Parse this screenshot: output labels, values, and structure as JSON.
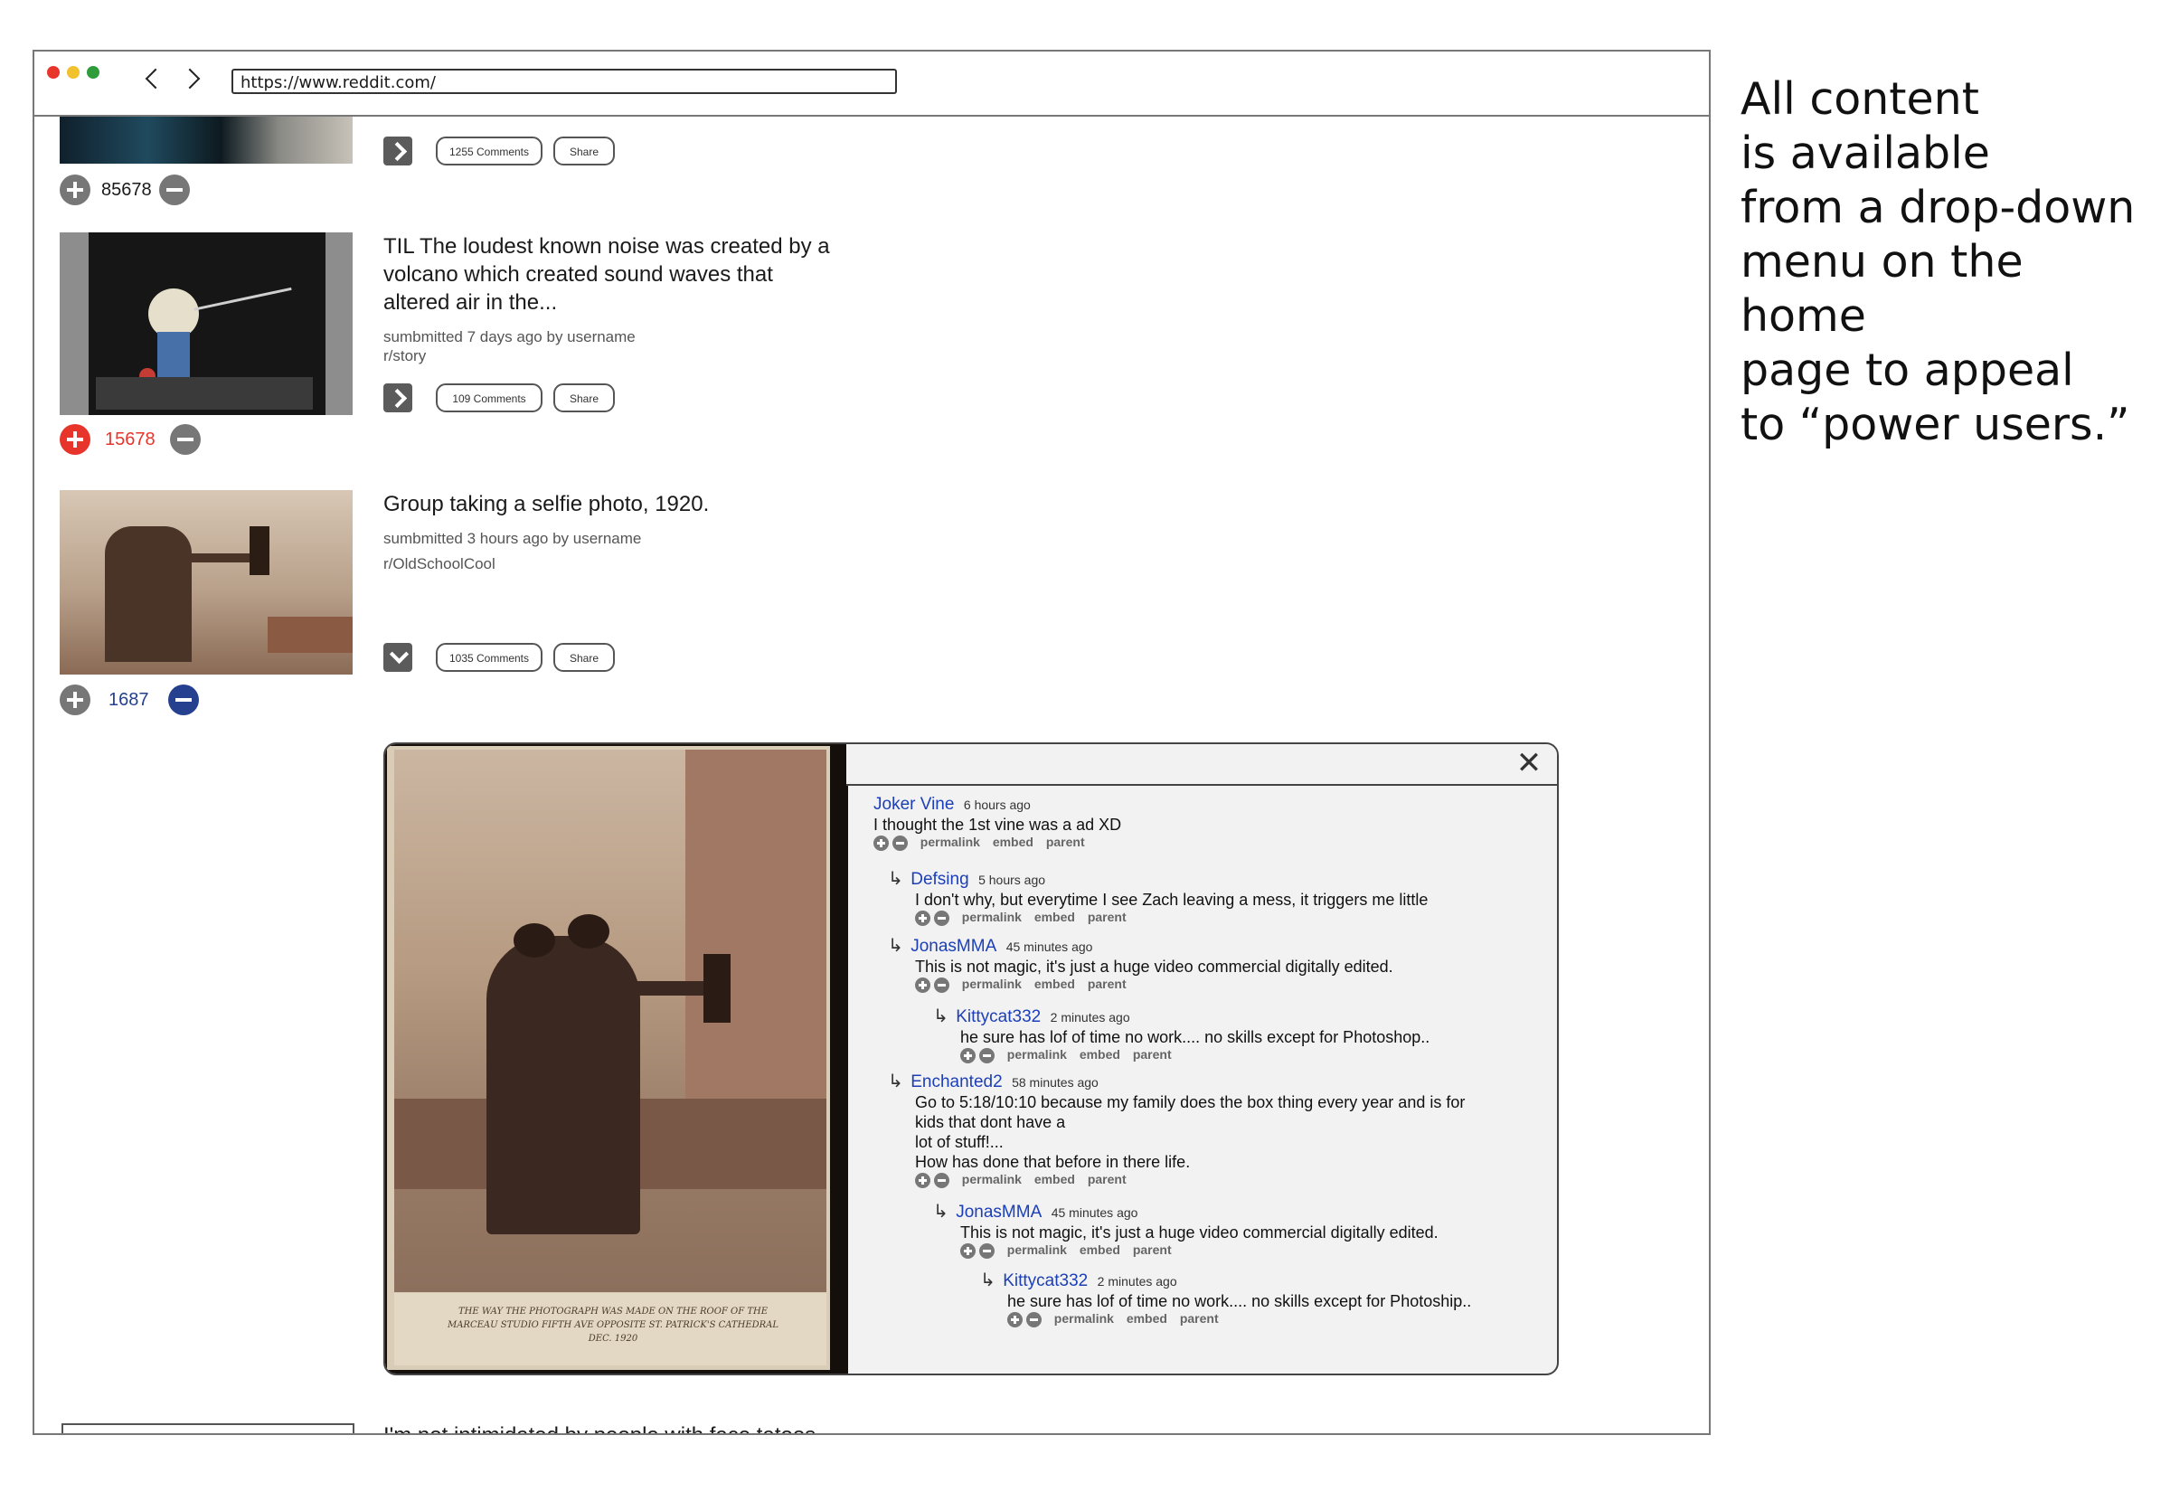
{
  "browser": {
    "url": "https://www.reddit.com/",
    "dots": {
      "red": "#e8352c",
      "yellow": "#f2c12e",
      "green": "#2e9c3b"
    }
  },
  "posts": [
    {
      "score": "85678",
      "comments_label": "1255 Comments",
      "share_label": "Share"
    },
    {
      "title": "TIL The loudest known noise was created by a volcano which created sound waves that altered air in the...",
      "meta": "sumbmitted 7 days ago by username",
      "subreddit": "r/story",
      "score": "15678",
      "comments_label": "109 Comments",
      "share_label": "Share"
    },
    {
      "title": "Group taking a selfie photo, 1920.",
      "meta": "sumbmitted 3 hours ago by username",
      "subreddit": "r/OldSchoolCool",
      "score": "1687",
      "comments_label": "1035 Comments",
      "share_label": "Share"
    },
    {
      "title": "I'm not intimidated by people with face tatoos because I think they're badass,"
    }
  ],
  "panel": {
    "close": "✕",
    "photo_caption": "THE WAY THE PHOTOGRAPH WAS MADE ON THE ROOF OF THE MARCEAU STUDIO FIFTH AVE OPPOSITE ST. PATRICK'S CATHEDRAL DEC. 1920",
    "actions": {
      "permalink": "permalink",
      "embed": "embed",
      "parent": "parent"
    },
    "comments": [
      {
        "user": "Joker Vine",
        "time": "6 hours ago",
        "text": "I thought the 1st vine was a ad XD"
      },
      {
        "user": "Defsing",
        "time": "5 hours ago",
        "text": "I don't why, but everytime I see Zach leaving a mess, it triggers me little"
      },
      {
        "user": "JonasMMA",
        "time": "45 minutes ago",
        "text": "This is not magic, it's just a huge video commercial digitally edited."
      },
      {
        "user": "Kittycat332",
        "time": "2 minutes ago",
        "text": "he sure has lof of time no work.... no skills except for Photoshop.."
      },
      {
        "user": "Enchanted2",
        "time": "58 minutes ago",
        "text_lines": [
          "Go to 5:18/10:10 because my family does the box thing every year and is for",
          "kids that dont have a",
          "lot of stuff!...",
          "How has done that before in there life."
        ]
      },
      {
        "user": "JonasMMA",
        "time": "45 minutes ago",
        "text": "This is not magic, it's just a huge video commercial digitally edited."
      },
      {
        "user": "Kittycat332",
        "time": "2 minutes ago",
        "text": "he sure has lof of time no work.... no skills except for Photoship.."
      }
    ]
  },
  "side_note": {
    "lines": [
      "All content",
      "is available",
      "from a drop-down",
      "menu on the home",
      "page to appeal",
      "to “power users.”"
    ]
  }
}
